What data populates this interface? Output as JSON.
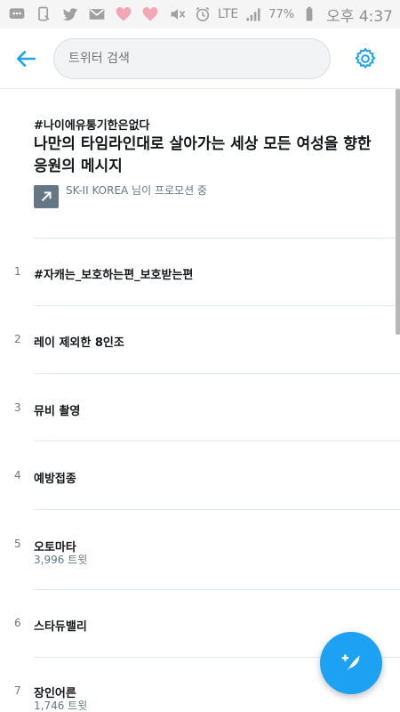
{
  "status_bar": {
    "lte": "LTE",
    "battery_pct": "77%",
    "time": "오후 4:37",
    "icons": [
      "message-icon",
      "cast-icon",
      "twitter-icon",
      "gmail-icon",
      "heart-icon",
      "heart-icon",
      "mute-icon",
      "alarm-icon",
      "signal-icon",
      "battery-icon"
    ]
  },
  "app_bar": {
    "search_placeholder": "트위터 검색"
  },
  "promoted": {
    "hashtag": "#나이에유통기한은없다",
    "title": "나만의 타임라인대로 살아가는 세상 모든 여성을 향한 응원의 메시지",
    "sponsor": "SK-II KOREA 님이 프로모션 중"
  },
  "trends": [
    {
      "rank": "1",
      "name": "#자캐는_보호하는편_보호받는편",
      "count": ""
    },
    {
      "rank": "2",
      "name": "레이 제외한 8인조",
      "count": ""
    },
    {
      "rank": "3",
      "name": "뮤비 촬영",
      "count": ""
    },
    {
      "rank": "4",
      "name": "예방접종",
      "count": ""
    },
    {
      "rank": "5",
      "name": "오토마타",
      "count": "3,996 트윗"
    },
    {
      "rank": "6",
      "name": "스타듀밸리",
      "count": ""
    },
    {
      "rank": "7",
      "name": "장인어른",
      "count": "1,746 트윗"
    }
  ],
  "colors": {
    "accent": "#1da1f2",
    "text_primary": "#14171a",
    "text_secondary": "#657786"
  }
}
